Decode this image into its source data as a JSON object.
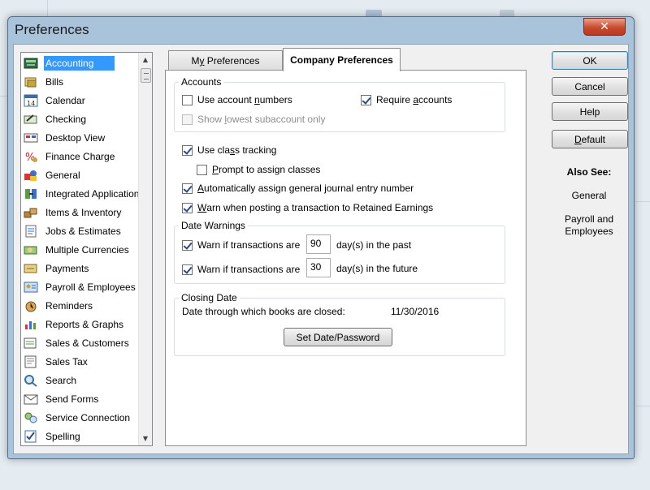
{
  "window": {
    "title": "Preferences",
    "close_glyph": "✕"
  },
  "sidebar": {
    "items": [
      {
        "label": "Accounting",
        "icon": "accounting-icon",
        "selected": true
      },
      {
        "label": "Bills",
        "icon": "bills-icon"
      },
      {
        "label": "Calendar",
        "icon": "calendar-icon",
        "icon_text": "14"
      },
      {
        "label": "Checking",
        "icon": "checking-icon"
      },
      {
        "label": "Desktop View",
        "icon": "desktop-view-icon"
      },
      {
        "label": "Finance Charge",
        "icon": "finance-charge-icon"
      },
      {
        "label": "General",
        "icon": "general-icon"
      },
      {
        "label": "Integrated Applications",
        "icon": "integrated-applications-icon"
      },
      {
        "label": "Items & Inventory",
        "icon": "items-inventory-icon"
      },
      {
        "label": "Jobs & Estimates",
        "icon": "jobs-estimates-icon"
      },
      {
        "label": "Multiple Currencies",
        "icon": "multiple-currencies-icon"
      },
      {
        "label": "Payments",
        "icon": "payments-icon"
      },
      {
        "label": "Payroll & Employees",
        "icon": "payroll-employees-icon"
      },
      {
        "label": "Reminders",
        "icon": "reminders-icon"
      },
      {
        "label": "Reports & Graphs",
        "icon": "reports-graphs-icon"
      },
      {
        "label": "Sales & Customers",
        "icon": "sales-customers-icon"
      },
      {
        "label": "Sales Tax",
        "icon": "sales-tax-icon"
      },
      {
        "label": "Search",
        "icon": "search-icon"
      },
      {
        "label": "Send Forms",
        "icon": "send-forms-icon"
      },
      {
        "label": "Service Connection",
        "icon": "service-connection-icon"
      },
      {
        "label": "Spelling",
        "icon": "spelling-icon"
      }
    ]
  },
  "tabs": {
    "my_prefix": "M",
    "my_underlined": "y",
    "my_rest": " Preferences",
    "company": "Company Preferences"
  },
  "accounts": {
    "title": "Accounts",
    "use_account_numbers": {
      "pre": "Use account ",
      "u": "n",
      "post": "umbers",
      "checked": false
    },
    "require_accounts": {
      "pre": "Require ",
      "u": "a",
      "post": "ccounts",
      "checked": true
    },
    "show_lowest": {
      "pre": "Show ",
      "u": "l",
      "post": "owest subaccount only",
      "checked": false,
      "disabled": true
    }
  },
  "options": {
    "class_tracking": {
      "pre": "Use cla",
      "u": "s",
      "post": "s tracking",
      "checked": true
    },
    "prompt_classes": {
      "pre": "",
      "u": "P",
      "post": "rompt to assign classes",
      "checked": false
    },
    "auto_journal": {
      "pre": "",
      "u": "A",
      "post": "utomatically assign general journal entry number",
      "checked": true
    },
    "warn_retained": {
      "pre": "",
      "u": "W",
      "post": "arn when posting a transaction to Retained Earnings",
      "checked": true
    }
  },
  "date_warnings": {
    "title": "Date Warnings",
    "past": {
      "label": "Warn if transactions are",
      "value": "90",
      "suffix": "day(s) in the past",
      "checked": true
    },
    "future": {
      "label": "Warn if transactions are",
      "value": "30",
      "suffix": "day(s) in the future",
      "checked": true
    }
  },
  "closing_date": {
    "title": "Closing Date",
    "label": "Date through which books are closed:",
    "date": "11/30/2016",
    "button": "Set Date/Password"
  },
  "buttons": {
    "ok": "OK",
    "cancel": "Cancel",
    "help": "Help",
    "default_u": "D",
    "default_rest": "efault"
  },
  "also_see": {
    "title": "Also See:",
    "links": [
      "General",
      "Payroll and",
      "Employees"
    ]
  },
  "colors": {
    "selection": "#3399ff",
    "window_frame": "#a9c3da",
    "close_button": "#c94a2e"
  }
}
